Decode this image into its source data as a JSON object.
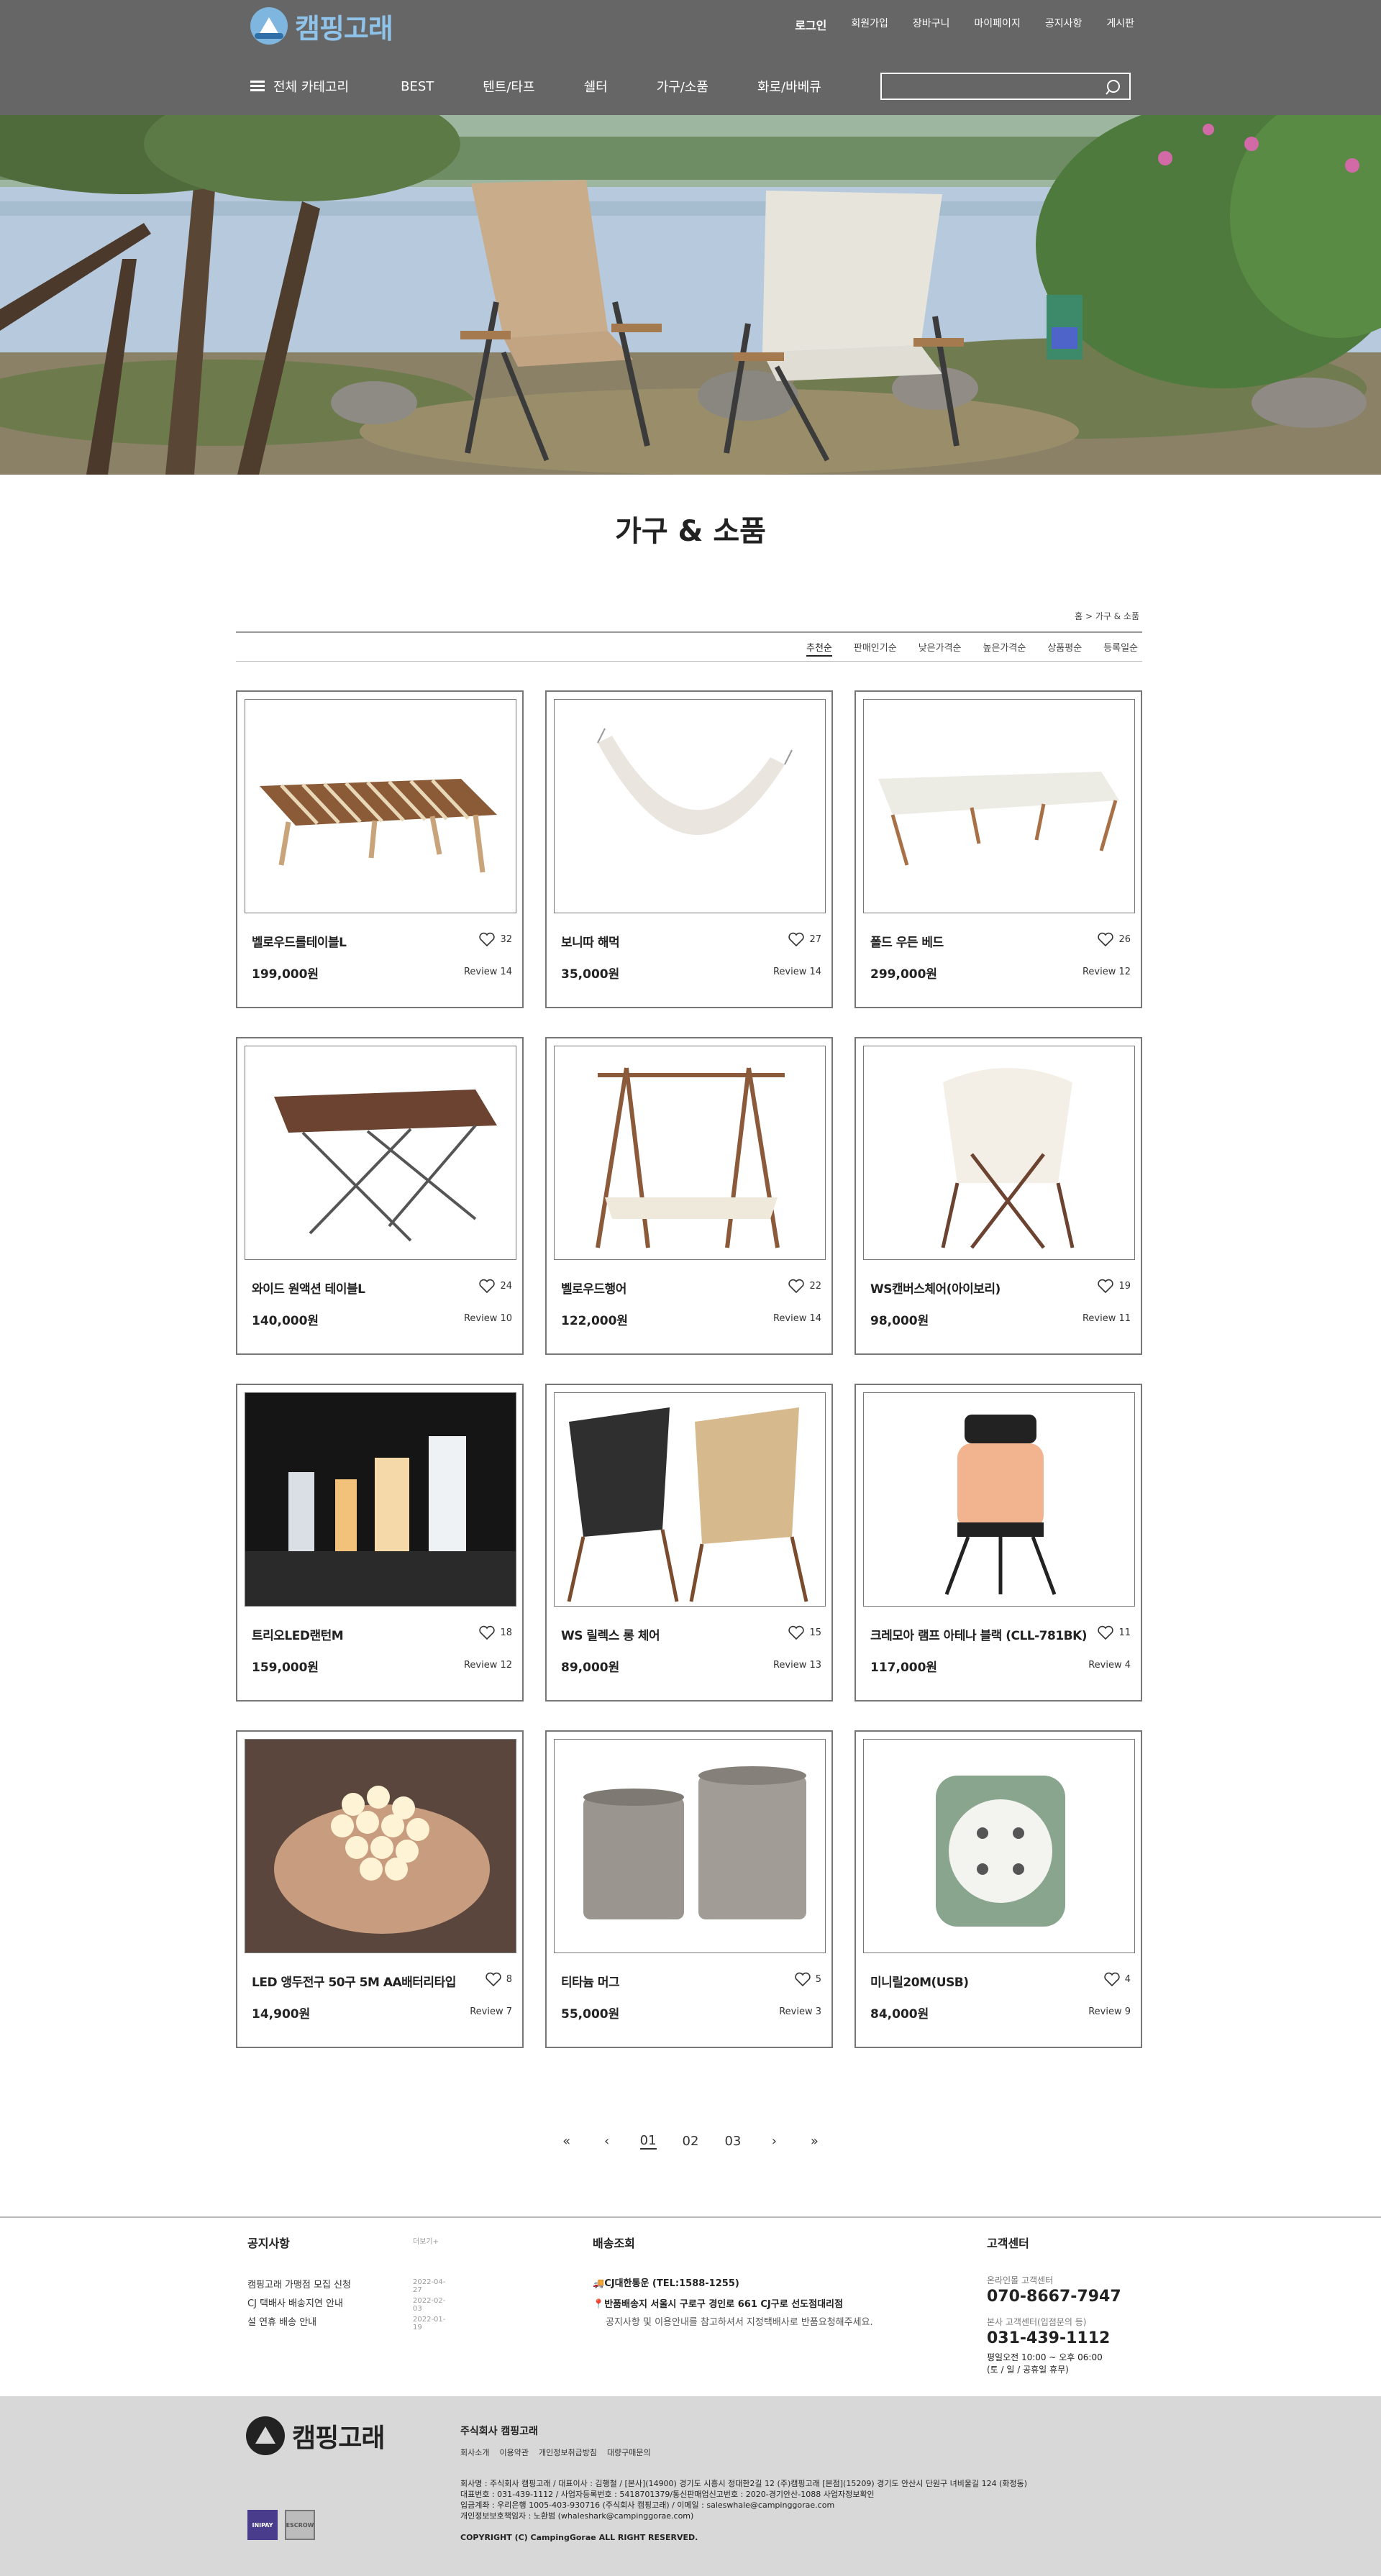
{
  "header": {
    "logo_text": "캠핑고래",
    "util_links": [
      "로그인",
      "회원가입",
      "장바구니",
      "마이페이지",
      "공지사항",
      "게시판"
    ],
    "all_category": "전체 카테고리",
    "nav": [
      "BEST",
      "텐트/타프",
      "쉘터",
      "가구/소품",
      "화로/바베큐"
    ],
    "search_placeholder": "",
    "colors": {
      "bar": "#666666",
      "logo": "#8fc3ea"
    }
  },
  "page": {
    "title": "가구 & 소품",
    "breadcrumb": "홈 > 가구 & 소품",
    "sort_options": [
      "추천순",
      "판매인기순",
      "낮은가격순",
      "높은가격순",
      "상품평순",
      "등록일순"
    ],
    "active_sort": "추천순"
  },
  "products": [
    {
      "name": "벨로우드롤테이블L",
      "price": "199,000원",
      "likes": "32",
      "review": "Review  14",
      "image": "wood-roll-table"
    },
    {
      "name": "보니따 해먹",
      "price": "35,000원",
      "likes": "27",
      "review": "Review  14",
      "image": "hammock"
    },
    {
      "name": "폴드 우든 베드",
      "price": "299,000원",
      "likes": "26",
      "review": "Review  12",
      "image": "cot-bed"
    },
    {
      "name": "와이드 원액션 테이블L",
      "price": "140,000원",
      "likes": "24",
      "review": "Review  10",
      "image": "folding-table"
    },
    {
      "name": "벨로우드행어",
      "price": "122,000원",
      "likes": "22",
      "review": "Review  14",
      "image": "hanger-rack"
    },
    {
      "name": "WS캔버스체어(아이보리)",
      "price": "98,000원",
      "likes": "19",
      "review": "Review  11",
      "image": "canvas-chair"
    },
    {
      "name": "트리오LED랜턴M",
      "price": "159,000원",
      "likes": "18",
      "review": "Review  12",
      "image": "led-lanterns"
    },
    {
      "name": "WS 릴렉스 롱 체어",
      "price": "89,000원",
      "likes": "15",
      "review": "Review  13",
      "image": "relax-chairs"
    },
    {
      "name": "크레모아 램프 아테나 블랙 (CLL-781BK)",
      "price": "117,000원",
      "likes": "11",
      "review": "Review  4",
      "image": "lamp"
    },
    {
      "name": "LED 앵두전구 50구 5M AA배터리타입",
      "price": "14,900원",
      "likes": "8",
      "review": "Review  7",
      "image": "string-lights"
    },
    {
      "name": "티타늄 머그",
      "price": "55,000원",
      "likes": "5",
      "review": "Review  3",
      "image": "titanium-mugs"
    },
    {
      "name": "미니릴20M(USB)",
      "price": "84,000원",
      "likes": "4",
      "review": "Review  9",
      "image": "cord-reel"
    }
  ],
  "pager": {
    "first": "«",
    "prev": "‹",
    "pages": [
      "01",
      "02",
      "03"
    ],
    "current": "01",
    "next": "›",
    "last": "»"
  },
  "footer": {
    "notice_title": "공지사항",
    "notice_more": "더보기+",
    "notices": [
      {
        "title": "캠핑고래 가맹점 모집 신청",
        "date": "2022-04-27"
      },
      {
        "title": "CJ 택배사 배송지연 안내",
        "date": "2022-02-03"
      },
      {
        "title": "설 연휴 배송 안내",
        "date": "2022-01-19"
      }
    ],
    "delivery_title": "배송조회",
    "delivery_line1": "CJ대한통운 (TEL:1588-1255)",
    "delivery_line2": "반품배송지 서울시 구로구 경인로 661 CJ구로 선도점대리점",
    "delivery_line3": "공지사항 및 이용안내를 참고하셔서 지정택배사로 반품요청해주세요.",
    "cs_title": "고객센터",
    "cs_label1": "온라인몰 고객센터",
    "cs_phone1": "070-8667-7947",
    "cs_label2": "본사 고객센터(입점문의 등)",
    "cs_phone2": "031-439-1112",
    "cs_hours1": "평일오전 10:00 ~ 오후 06:00",
    "cs_hours2": "(토 / 일 / 공휴일 휴무)",
    "company": "주식회사 캠핑고래",
    "links": [
      "회사소개",
      "이용약관",
      "개인정보취급방침",
      "대량구매문의"
    ],
    "biz1": "회사명 : 주식회사 캠핑고래  /  대표이사 : 김행철  /  [본사](14900) 경기도 시흥시 정대한2길 12 (주)캠핑고래 [본점](15209) 경기도 안산시 단원구 녀비울길 124 (화정동)",
    "biz2": "대표번호 : 031-439-1112  /  사업자등록번호 : 5418701379/통신판매업신고번호 : 2020-경기안산-1088  사업자정보확인",
    "biz3": "입금계좌 : 우리은행 1005-403-930716 (주식회사 캠핑고래)  /  이메일 : saleswhale@campinggorae.com",
    "biz4": "개인정보보호책임자 : 노환범 (whaleshark@campinggorae.com)",
    "copyright": "COPYRIGHT (C) CampingGorae ALL RIGHT RESERVED.",
    "badge1": "INIPAY",
    "badge2": "ESCROW"
  }
}
